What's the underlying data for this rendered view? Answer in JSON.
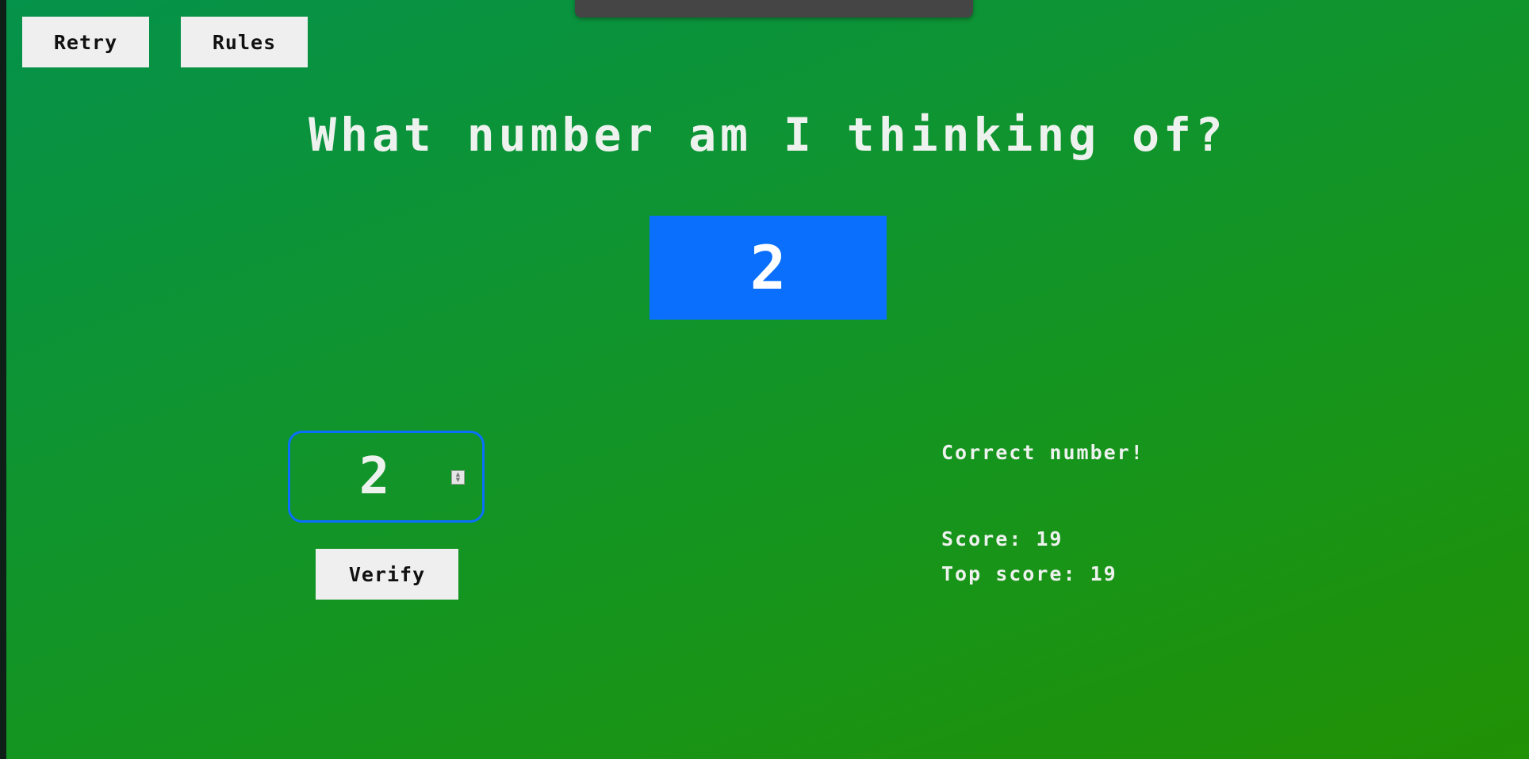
{
  "header": {
    "retry_label": "Retry",
    "rules_label": "Rules"
  },
  "game": {
    "title": "What number am I thinking of?",
    "secret_number": "2",
    "guess_value": "2",
    "verify_label": "Verify",
    "message": "Correct number!",
    "score_text": "Score: 19",
    "top_score_text": "Top score: 19"
  },
  "colors": {
    "background_start": "#05924a",
    "background_end": "#219105",
    "accent": "#0a6ffc",
    "button_bg": "#efefef",
    "text": "#eef2ee"
  },
  "icons": {
    "spinner": "number-spinner-icon"
  }
}
